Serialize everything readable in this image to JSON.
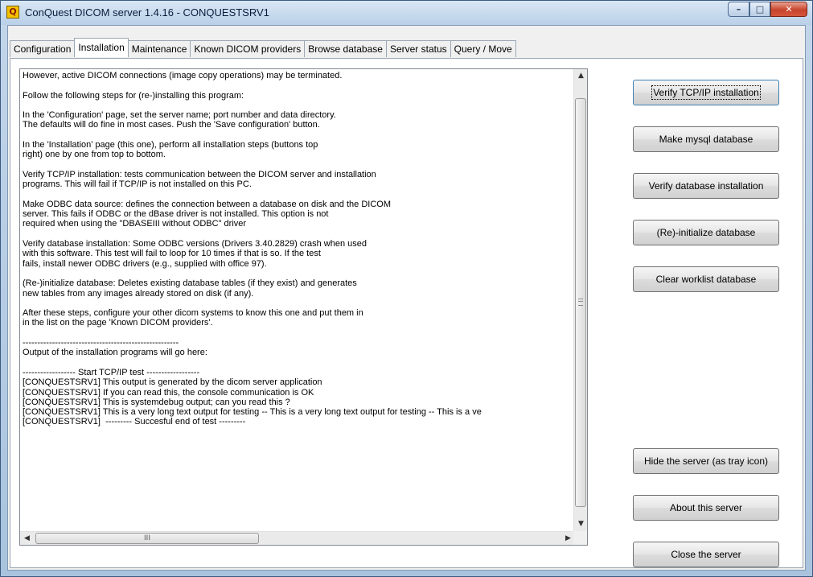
{
  "window": {
    "title": "ConQuest DICOM server 1.4.16 - CONQUESTSRV1",
    "app_icon_glyph": "Q",
    "minimize_glyph": "–",
    "maximize_glyph": "□",
    "close_glyph": "✕"
  },
  "tabs": [
    {
      "label": "Configuration"
    },
    {
      "label": "Installation"
    },
    {
      "label": "Maintenance"
    },
    {
      "label": "Known DICOM providers"
    },
    {
      "label": "Browse database"
    },
    {
      "label": "Server status"
    },
    {
      "label": "Query / Move"
    }
  ],
  "active_tab": "Installation",
  "log": {
    "text": "However, active DICOM connections (image copy operations) may be terminated.\n\nFollow the following steps for (re-)installing this program:\n\nIn the 'Configuration' page, set the server name; port number and data directory.\nThe defaults will do fine in most cases. Push the 'Save configuration' button.\n\nIn the 'Installation' page (this one), perform all installation steps (buttons top\nright) one by one from top to bottom.\n\nVerify TCP/IP installation: tests communication between the DICOM server and installation\nprograms. This will fail if TCP/IP is not installed on this PC.\n\nMake ODBC data source: defines the connection between a database on disk and the DICOM\nserver. This fails if ODBC or the dBase driver is not installed. This option is not\nrequired when using the \"DBASEIII without ODBC\" driver\n\nVerify database installation: Some ODBC versions (Drivers 3.40.2829) crash when used\nwith this software. This test will fail to loop for 10 times if that is so. If the test\nfails, install newer ODBC drivers (e.g., supplied with office 97).\n\n(Re-)initialize database: Deletes existing database tables (if they exist) and generates\nnew tables from any images already stored on disk (if any).\n\nAfter these steps, configure your other dicom systems to know this one and put them in\nin the list on the page 'Known DICOM providers'.\n\n-----------------------------------------------------\nOutput of the installation programs will go here:\n\n------------------ Start TCP/IP test ------------------\n[CONQUESTSRV1] This output is generated by the dicom server application\n[CONQUESTSRV1] If you can read this, the console communication is OK\n[CONQUESTSRV1] This is systemdebug output; can you read this ?\n[CONQUESTSRV1] This is a very long text output for testing -- This is a very long text output for testing -- This is a ve\n[CONQUESTSRV1]  --------- Succesful end of test ---------",
    "scroll_up_glyph": "▲",
    "scroll_down_glyph": "▼",
    "scroll_left_glyph": "◀",
    "scroll_right_glyph": "▶",
    "hthumb_grip": "III"
  },
  "buttons": {
    "verify_tcpip": "Verify TCP/IP installation",
    "make_mysql": "Make mysql database",
    "verify_database": "Verify database installation",
    "reinit_database": "(Re)-initialize database",
    "clear_worklist": "Clear worklist database",
    "hide_server": "Hide the server (as tray icon)",
    "about_server": "About this server",
    "close_server": "Close the server"
  },
  "colors": {
    "title_bar": "#b9d0e8",
    "close_button": "#c7432b",
    "focus_border": "#3c7fb1"
  }
}
